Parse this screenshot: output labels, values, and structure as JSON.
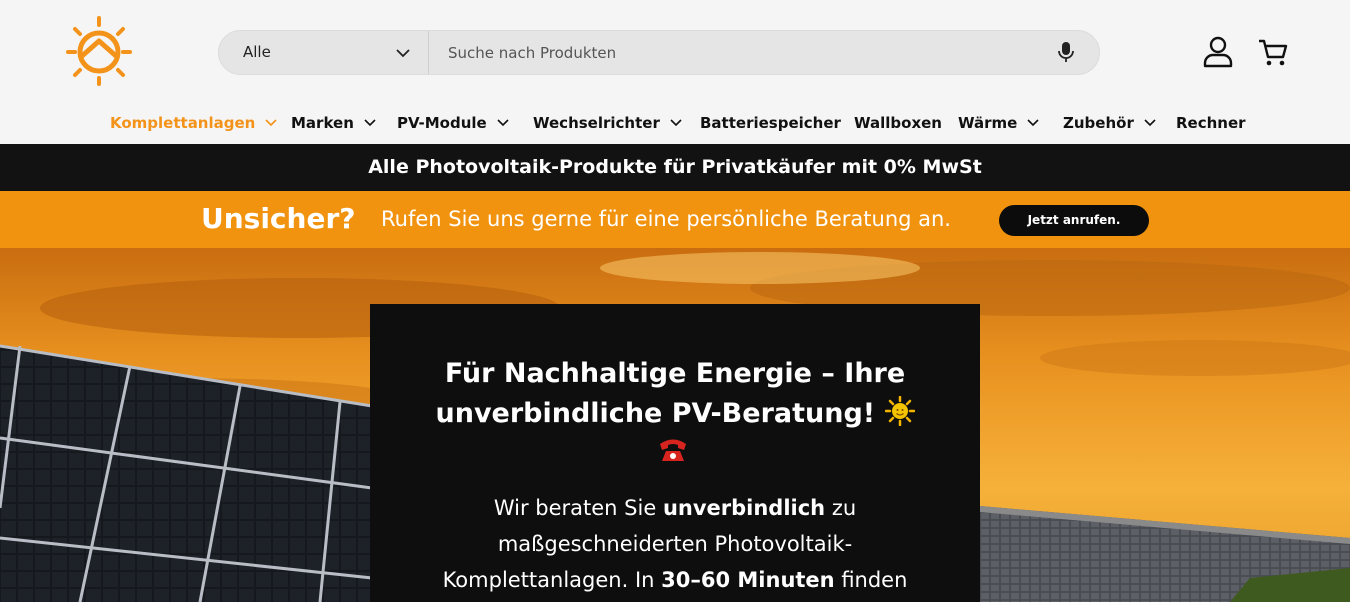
{
  "brand": {
    "accent": "#f3931a",
    "dark": "#121212"
  },
  "search": {
    "category_label": "Alle",
    "placeholder": "Suche nach Produkten",
    "icons": [
      "chevron-down-icon",
      "microphone-icon"
    ]
  },
  "header_icons": [
    "account-icon",
    "cart-icon"
  ],
  "nav": {
    "items": [
      {
        "label": "Komplettanlagen",
        "dropdown": true,
        "active": true
      },
      {
        "label": "Marken",
        "dropdown": true
      },
      {
        "label": "PV-Module",
        "dropdown": true
      },
      {
        "label": "Wechselrichter",
        "dropdown": true
      },
      {
        "label": "Batteriespeicher",
        "dropdown": false
      },
      {
        "label": "Wallboxen",
        "dropdown": false
      },
      {
        "label": "Wärme",
        "dropdown": true
      },
      {
        "label": "Zubehör",
        "dropdown": true
      },
      {
        "label": "Rechner",
        "dropdown": false
      }
    ]
  },
  "promo_text": "Alle Photovoltaik-Produkte für Privatkäufer mit 0% MwSt",
  "callbar": {
    "heading": "Unsicher?",
    "text": "Rufen Sie uns gerne für eine persönliche Beratung an.",
    "button": "Jetzt anrufen."
  },
  "hero_card": {
    "title_line1": "Für Nachhaltige Energie – Ihre",
    "title_line2": "unverbindliche PV-Beratung!",
    "title_emoji": "🌞",
    "phone_icon": "telephone-icon",
    "body": {
      "l1_a": "Wir beraten Sie ",
      "l1_b": "unverbindlich",
      "l1_c": " zu",
      "l2": "maßgeschneiderten Photovoltaik-",
      "l3_a": "Komplettanlagen. In ",
      "l3_b": "30–60 Minuten",
      "l3_c": " finden"
    }
  }
}
